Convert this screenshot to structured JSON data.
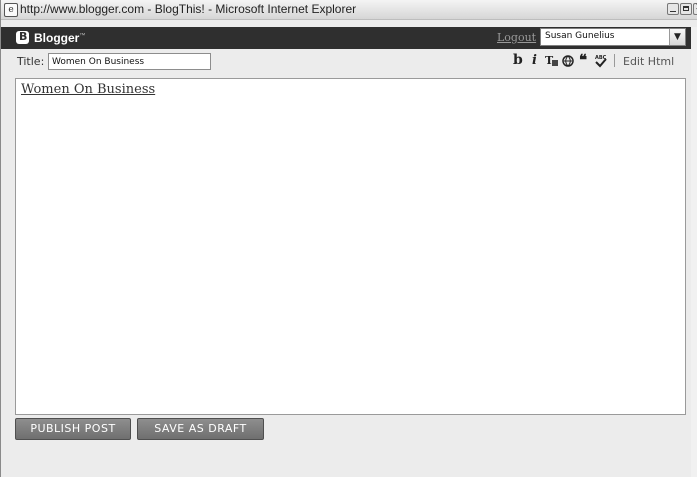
{
  "window": {
    "title": "http://www.blogger.com - BlogThis! - Microsoft Internet Explorer"
  },
  "header": {
    "brand": "Blogger",
    "brand_mark": "B",
    "trademark": "™",
    "logout_label": "Logout",
    "user_selected": "Susan Gunelius"
  },
  "post": {
    "title_label": "Title:",
    "title_value": "Women On Business",
    "body_text": "Women On Business"
  },
  "toolbar": {
    "bold_label": "b",
    "italic_label": "i",
    "quote_label": "❝",
    "edit_html_label": "Edit Html",
    "icons": [
      "bold-icon",
      "italic-icon",
      "font-color-icon",
      "link-icon",
      "blockquote-icon",
      "spellcheck-icon"
    ]
  },
  "actions": {
    "publish_label": "PUBLISH POST",
    "draft_label": "SAVE AS DRAFT"
  },
  "colors": {
    "header_bg": "#2f2f2f",
    "button_bg": "#7f7f7f",
    "window_bg": "#ececec"
  }
}
